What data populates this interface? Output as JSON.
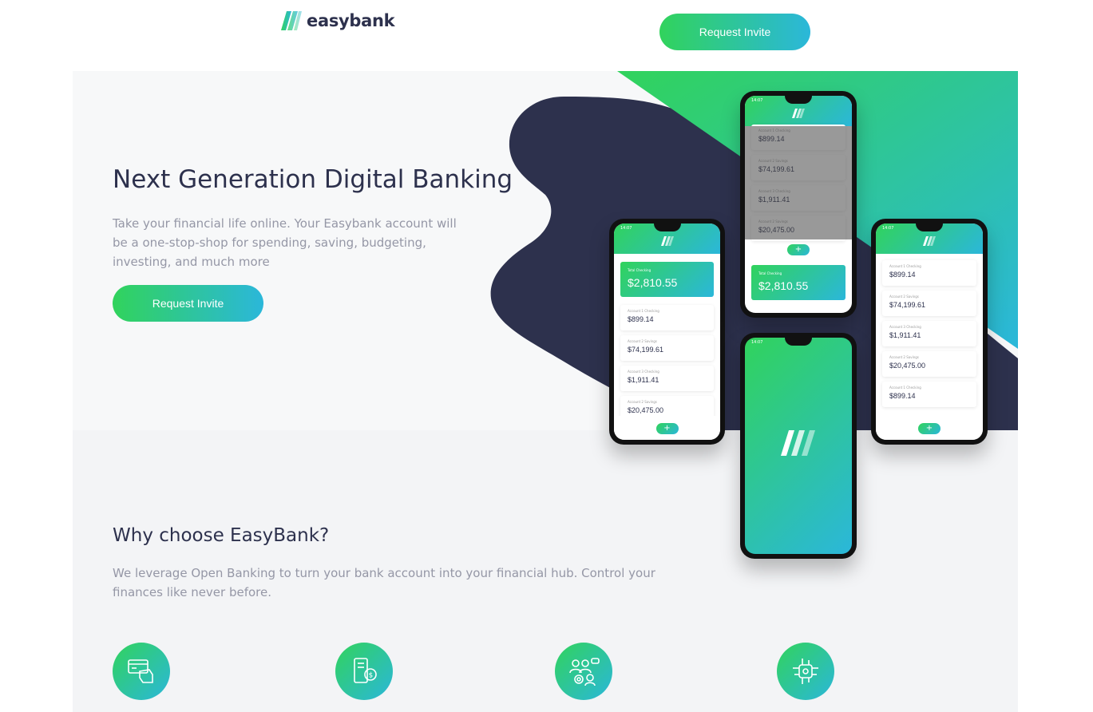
{
  "header": {
    "logo_text": "easybank",
    "cta_label": "Request Invite"
  },
  "hero": {
    "title": "Next Generation Digital Banking",
    "text": "Take your financial life online. Your Easybank account will be a one-stop-shop for spending, saving, budgeting, investing, and much more",
    "cta_label": "Request Invite"
  },
  "phone_app": {
    "time": "14:07",
    "total_label": "Total Checking",
    "total_amount": "$2,810.55",
    "fab_symbol": "+",
    "accounts": [
      {
        "label": "Account 1 Checking",
        "amount": "$899.14"
      },
      {
        "label": "Account 2 Savings",
        "amount": "$74,199.61"
      },
      {
        "label": "Account 3 Checking",
        "amount": "$1,911.41"
      },
      {
        "label": "Account 2 Savings",
        "amount": "$20,475.00"
      },
      {
        "label": "Account 1 Checking",
        "amount": "$899.14"
      }
    ]
  },
  "why": {
    "title": "Why choose EasyBank?",
    "text": "We leverage Open Banking to turn your bank account into your financial hub. Control your finances like never before.",
    "feature_icons": [
      "online-banking-icon",
      "budgeting-icon",
      "onboarding-icon",
      "api-icon"
    ]
  },
  "colors": {
    "primary": "#2d314d",
    "lime_green": "#31d35c",
    "bright_cyan": "#2bb7da",
    "grayish_blue": "#9597a6",
    "light_bg": "#f3f4f6"
  }
}
